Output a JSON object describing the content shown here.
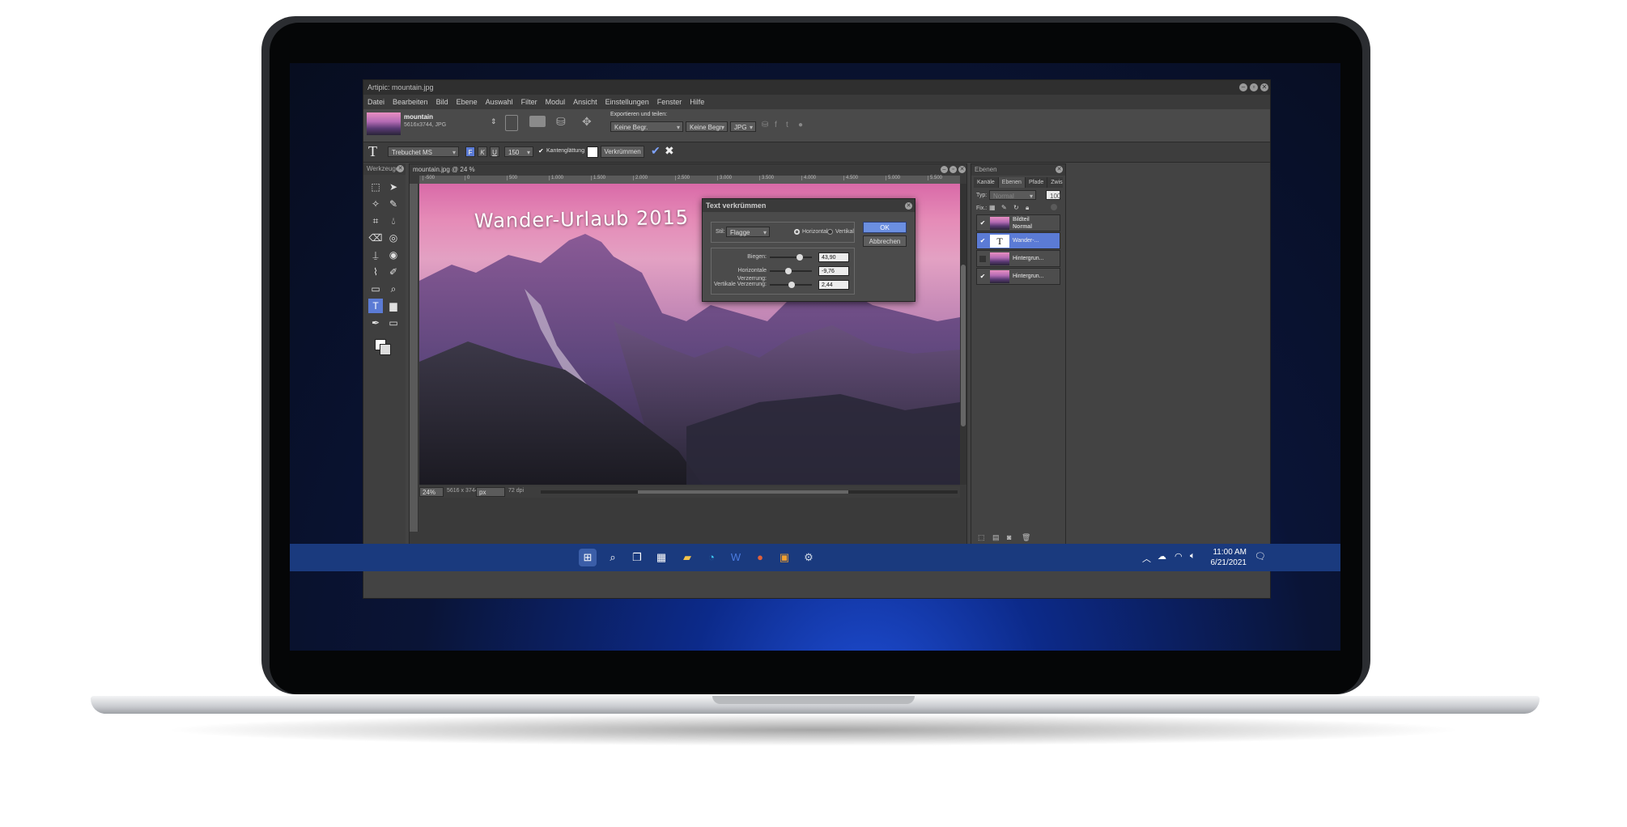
{
  "window": {
    "title": "Artipic: mountain.jpg"
  },
  "menu": [
    "Datei",
    "Bearbeiten",
    "Bild",
    "Ebene",
    "Auswahl",
    "Filter",
    "Modul",
    "Ansicht",
    "Einstellungen",
    "Fenster",
    "Hilfe"
  ],
  "file_info": {
    "name": "mountain",
    "details": "5616x3744, JPG"
  },
  "export": {
    "label": "Exportieren und teilen:",
    "format_select": "Keine Begr.",
    "size_select": "Keine Begr.",
    "type_select": "JPG"
  },
  "text_options": {
    "font": "Trebuchet MS",
    "bold": "F",
    "italic": "K",
    "underline": "U",
    "size": "150",
    "antialias_label": "Kantenglättung",
    "warp_button": "Verkrümmen"
  },
  "tools_panel": {
    "title": "Werkzeuge"
  },
  "document": {
    "title": "mountain.jpg @ 24 %",
    "ruler_ticks": [
      "-500",
      "0",
      "500",
      "1.000",
      "1.500",
      "2.000",
      "2.500",
      "3.000",
      "3.500",
      "4.000",
      "4.500",
      "5.000",
      "5.500"
    ],
    "canvas_text": "Wander-Urlaub 2015",
    "zoom": "24%",
    "dimensions": "5616 x 3744",
    "unit": "px",
    "dpi": "72 dpi"
  },
  "dialog": {
    "title": "Text verkrümmen",
    "style_label": "Stil:",
    "style_value": "Flagge",
    "horizontal_label": "Horizontal",
    "vertical_label": "Vertikal",
    "ok": "OK",
    "cancel": "Abbrechen",
    "sliders": [
      {
        "label": "Biegen:",
        "value": "43,90",
        "fraction": 0.72
      },
      {
        "label": "Horizontale Verzerrung:",
        "value": "-9,76",
        "fraction": 0.45
      },
      {
        "label": "Vertikale Verzerrung:",
        "value": "2,44",
        "fraction": 0.52
      }
    ]
  },
  "layers_panel": {
    "title": "Ebenen",
    "tabs": [
      "Kanäle",
      "Ebenen",
      "Pfade",
      "Zwischen"
    ],
    "type_label": "Typ:",
    "type_value": "Normal",
    "opacity_value": "100",
    "fix_label": "Fix.:",
    "layers": [
      {
        "name": "Bildteil",
        "sub": "Normal",
        "visible": true,
        "selected": false
      },
      {
        "name": "Wander-...",
        "sub": "",
        "visible": true,
        "selected": true
      },
      {
        "name": "Hintergrun...",
        "sub": "",
        "visible": false,
        "selected": false
      },
      {
        "name": "Hintergrun...",
        "sub": "",
        "visible": true,
        "selected": false
      }
    ]
  },
  "taskbar": {
    "time": "11:00 AM",
    "date": "6/21/2021"
  },
  "colors": {
    "accent": "#5b7bd5",
    "app_bg": "#434343",
    "taskbar": "#1a3a7e"
  }
}
